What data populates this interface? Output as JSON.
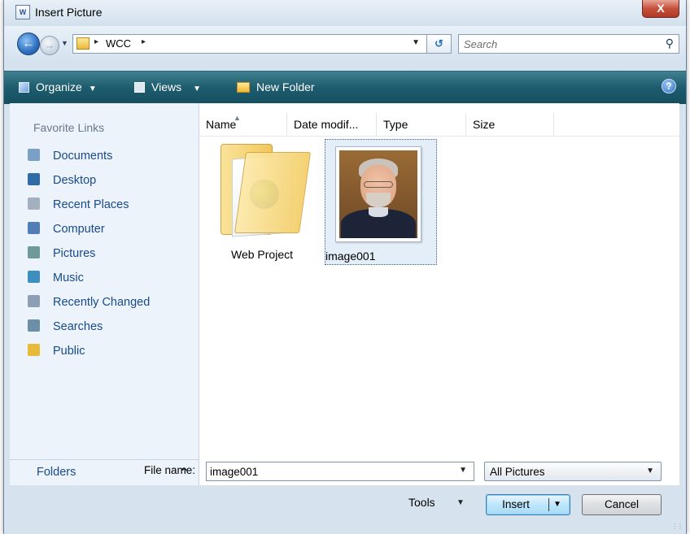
{
  "window": {
    "title": "Insert Picture",
    "title_icon_text": "W",
    "close_label": "X"
  },
  "address": {
    "path_separator": "▸",
    "path": "WCC",
    "search_placeholder": "Search"
  },
  "toolbar": {
    "organize": "Organize",
    "views": "Views",
    "new_folder": "New Folder",
    "help_label": "?"
  },
  "nav": {
    "favorites_title": "Favorite Links",
    "items": [
      {
        "label": "Documents",
        "icon": "documents-icon",
        "color": "#7aa0c6"
      },
      {
        "label": "Desktop",
        "icon": "desktop-icon",
        "color": "#2f6ca6"
      },
      {
        "label": "Recent Places",
        "icon": "recent-places-icon",
        "color": "#a3b0bf"
      },
      {
        "label": "Computer",
        "icon": "computer-icon",
        "color": "#4f7fb6"
      },
      {
        "label": "Pictures",
        "icon": "pictures-icon",
        "color": "#6e9a9a"
      },
      {
        "label": "Music",
        "icon": "music-icon",
        "color": "#3d8fbf"
      },
      {
        "label": "Recently Changed",
        "icon": "recently-changed-icon",
        "color": "#8d9fb5"
      },
      {
        "label": "Searches",
        "icon": "searches-icon",
        "color": "#6c8fa8"
      },
      {
        "label": "Public",
        "icon": "public-folder-icon",
        "color": "#e9b93a"
      }
    ],
    "folders_label": "Folders"
  },
  "columns": [
    "Name",
    "Date modif...",
    "Type",
    "Size"
  ],
  "files": [
    {
      "name": "Web Project",
      "kind": "folder"
    },
    {
      "name": "image001",
      "kind": "picture",
      "selected": true
    }
  ],
  "bottom": {
    "file_name_label": "File name:",
    "file_name_value": "image001",
    "filter": "All Pictures",
    "tools": "Tools",
    "insert": "Insert",
    "cancel": "Cancel"
  },
  "colors": {
    "toolbar": "#1d5c6d",
    "link_text": "#1a4a8a",
    "selection": "#e4eef9"
  }
}
